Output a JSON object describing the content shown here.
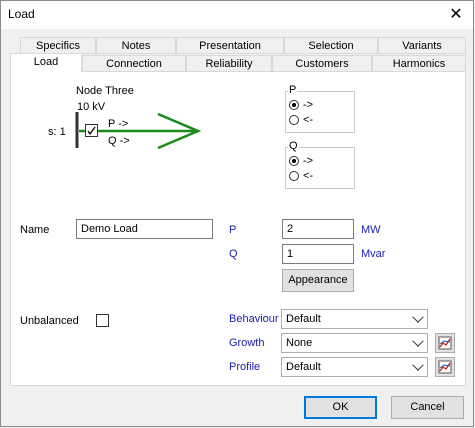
{
  "window": {
    "title": "Load",
    "close_glyph": "✕"
  },
  "tabs_row1": [
    "Specifics",
    "Notes",
    "Presentation",
    "Selection",
    "Variants"
  ],
  "tabs_row2": [
    "Load",
    "Connection",
    "Reliability",
    "Customers",
    "Harmonics"
  ],
  "active_tab": "Load",
  "diagram": {
    "node_name": "Node Three",
    "voltage": "10 kV",
    "switch_state": "s: 1",
    "p_label": "P ->",
    "q_label": "Q ->",
    "arrow_color": "#1a8a1a"
  },
  "p_direction": {
    "label": "P",
    "options": [
      "->",
      "<-"
    ],
    "selected": 0
  },
  "q_direction": {
    "label": "Q",
    "options": [
      "->",
      "<-"
    ],
    "selected": 0
  },
  "name": {
    "label": "Name",
    "value": "Demo Load"
  },
  "power": {
    "p_label": "P",
    "p_value": "2",
    "p_unit": "MW",
    "q_label": "Q",
    "q_value": "1",
    "q_unit": "Mvar"
  },
  "appearance_button": "Appearance",
  "unbalanced": {
    "label": "Unbalanced",
    "checked": false
  },
  "behaviour": {
    "label": "Behaviour",
    "value": "Default"
  },
  "growth": {
    "label": "Growth",
    "value": "None"
  },
  "profile": {
    "label": "Profile",
    "value": "Default"
  },
  "ok_button": "OK",
  "cancel_button": "Cancel"
}
